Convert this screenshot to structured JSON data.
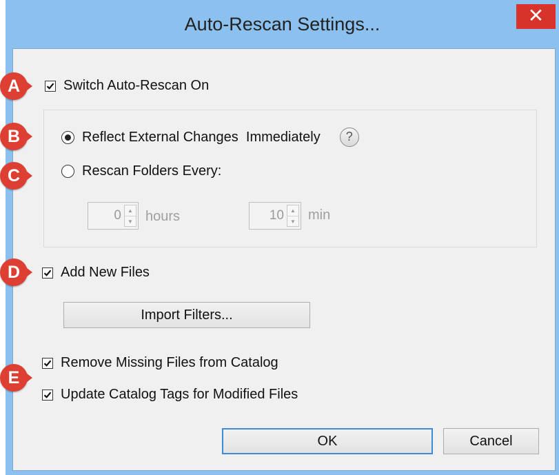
{
  "window": {
    "title": "Auto-Rescan Settings...",
    "close_glyph": "✕"
  },
  "auto_rescan": {
    "label": "Switch Auto-Rescan On",
    "checked": true
  },
  "mode": {
    "immediate_label": "Reflect External Changes  Immediately",
    "immediate_selected": true,
    "help_glyph": "?",
    "interval_label": "Rescan Folders Every:",
    "interval_selected": false
  },
  "interval": {
    "hours_value": "0",
    "hours_unit": "hours",
    "minutes_value": "10",
    "minutes_unit": "min",
    "up_glyph": "▲",
    "down_glyph": "▼"
  },
  "add_new_files": {
    "label": "Add New Files",
    "checked": true
  },
  "import_filters_button": "Import Filters...",
  "remove_missing": {
    "label": "Remove Missing Files from Catalog",
    "checked": true
  },
  "update_tags": {
    "label": "Update Catalog Tags for Modified Files",
    "checked": true
  },
  "buttons": {
    "ok": "OK",
    "cancel": "Cancel"
  },
  "check_glyph": "✔",
  "callouts": [
    "A",
    "B",
    "C",
    "D",
    "E"
  ],
  "colors": {
    "titlebar": "#8cc0ee",
    "close": "#d7332a",
    "callout": "#dd4033",
    "default_button_border": "#3c8ad8"
  }
}
